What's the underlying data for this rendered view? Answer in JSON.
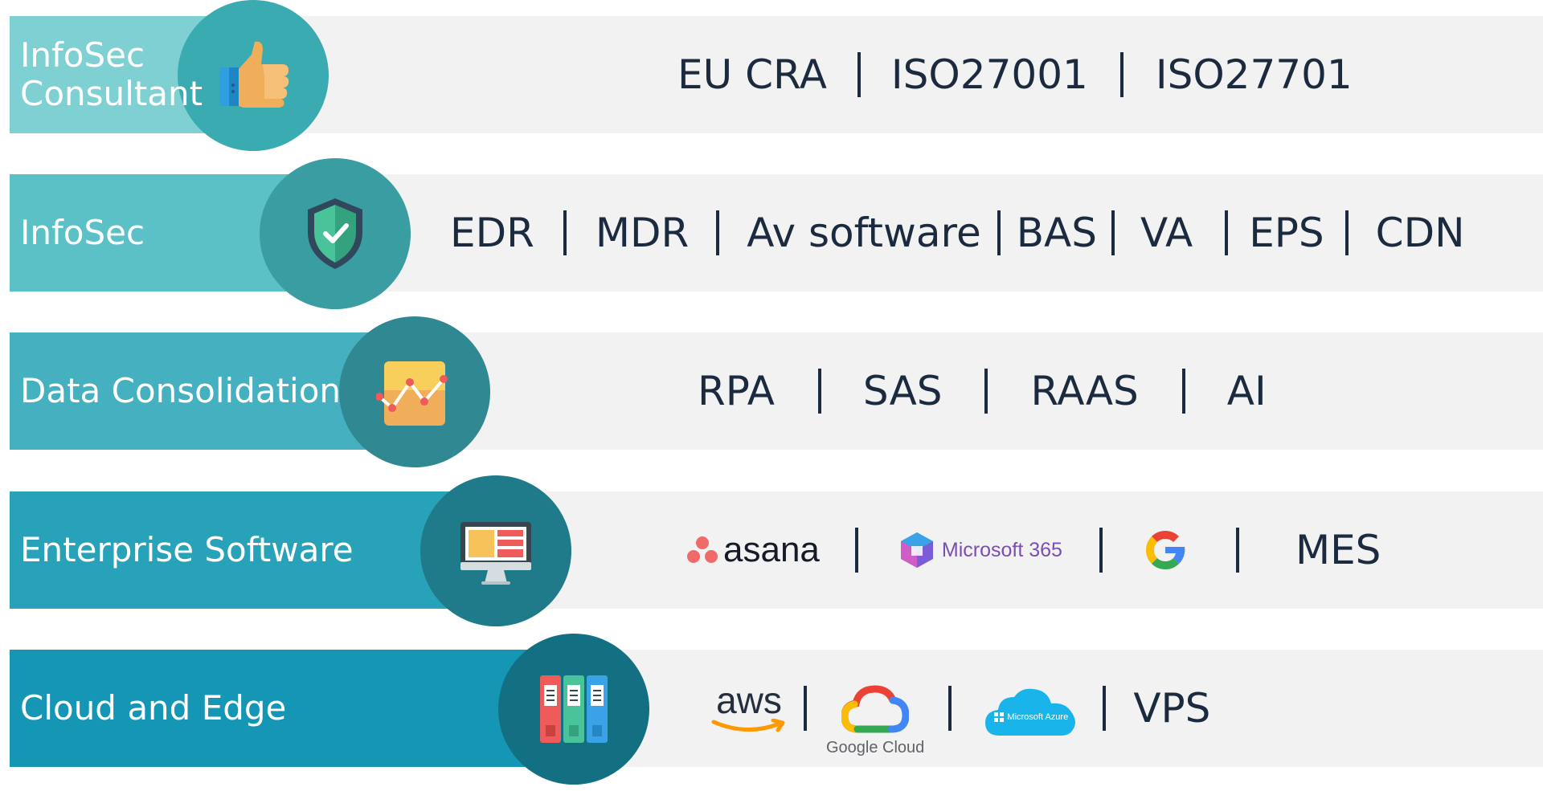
{
  "colors": {
    "item_text": "#1b2a3e",
    "band": "#f2f2f2",
    "row1_bar": "#7fd0d2",
    "row1_circle": "#3aabb0",
    "row2_bar": "#5bc1c6",
    "row2_circle": "#3a9da2",
    "row3_bar": "#45b1c0",
    "row3_circle": "#2f8892",
    "row4_bar": "#27a2b8",
    "row4_circle": "#1f7a8a",
    "row5_bar": "#1596b4",
    "row5_circle": "#136f82"
  },
  "rows": [
    {
      "label": "InfoSec\nConsultant",
      "icon": "thumbs-up-icon",
      "items": [
        "EU CRA",
        "ISO27001",
        "ISO27701"
      ]
    },
    {
      "label": "InfoSec",
      "icon": "shield-check-icon",
      "items": [
        "EDR",
        "MDR",
        "Av software",
        "BAS",
        "VA",
        "EPS",
        "CDN"
      ]
    },
    {
      "label": "Data Consolidation",
      "icon": "chart-board-icon",
      "items": [
        "RPA",
        "SAS",
        "RAAS",
        "AI"
      ]
    },
    {
      "label": "Enterprise Software",
      "icon": "monitor-icon",
      "items": [
        "MES"
      ],
      "logos": {
        "asana": "asana",
        "microsoft365": "Microsoft 365",
        "google": "google-g-logo"
      }
    },
    {
      "label": "Cloud and Edge",
      "icon": "binders-icon",
      "items": [
        "VPS"
      ],
      "logos": {
        "aws": "aws",
        "google_cloud": "Google Cloud",
        "azure": "Microsoft Azure"
      }
    }
  ]
}
